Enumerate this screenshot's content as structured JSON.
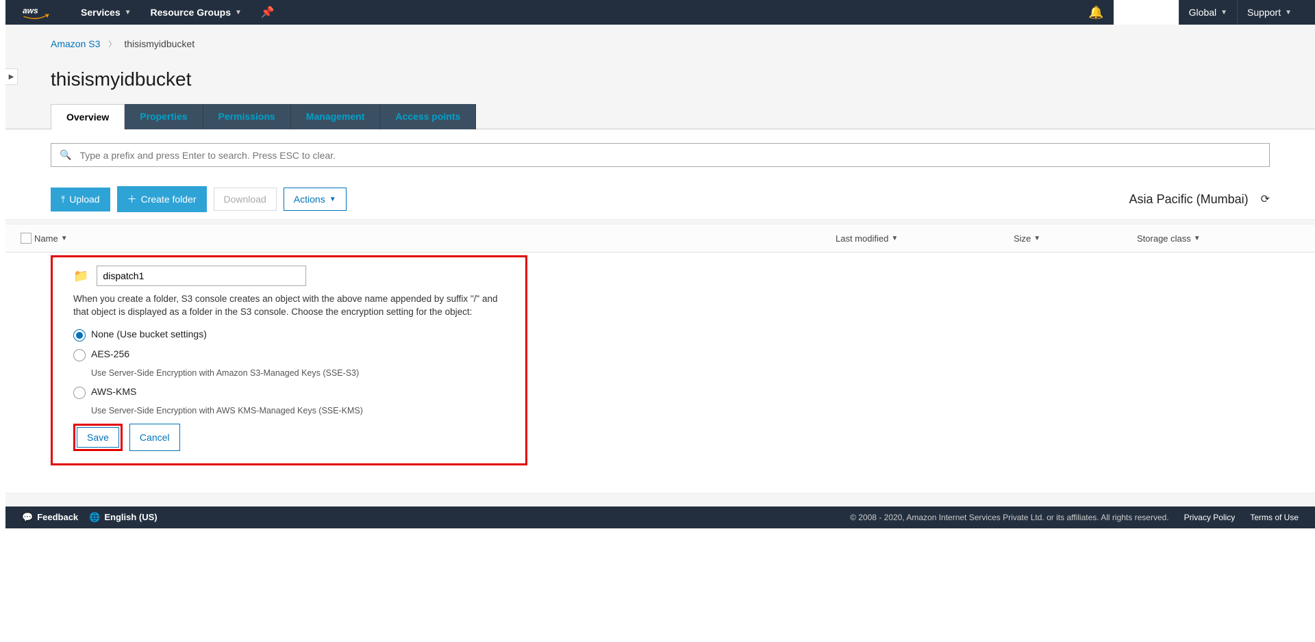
{
  "topnav": {
    "services": "Services",
    "resource_groups": "Resource Groups",
    "global": "Global",
    "support": "Support"
  },
  "breadcrumb": {
    "root": "Amazon S3",
    "current": "thisismyidbucket"
  },
  "heading": "thisismyidbucket",
  "tabs": {
    "overview": "Overview",
    "properties": "Properties",
    "permissions": "Permissions",
    "management": "Management",
    "access_points": "Access points"
  },
  "search": {
    "placeholder": "Type a prefix and press Enter to search. Press ESC to clear."
  },
  "actions": {
    "upload": "Upload",
    "create_folder": "Create folder",
    "download": "Download",
    "actions_menu": "Actions"
  },
  "region": {
    "label": "Asia Pacific (Mumbai)"
  },
  "table": {
    "name": "Name",
    "last_modified": "Last modified",
    "size": "Size",
    "storage_class": "Storage class"
  },
  "folder_form": {
    "input_value": "dispatch1",
    "description": "When you create a folder, S3 console creates an object with the above name appended by suffix \"/\" and that object is displayed as a folder in the S3 console. Choose the encryption setting for the object:",
    "opt_none": "None (Use bucket settings)",
    "opt_aes": "AES-256",
    "opt_aes_sub": "Use Server-Side Encryption with Amazon S3-Managed Keys (SSE-S3)",
    "opt_kms": "AWS-KMS",
    "opt_kms_sub": "Use Server-Side Encryption with AWS KMS-Managed Keys (SSE-KMS)",
    "save": "Save",
    "cancel": "Cancel"
  },
  "footer": {
    "feedback": "Feedback",
    "language": "English (US)",
    "copyright": "© 2008 - 2020, Amazon Internet Services Private Ltd. or its affiliates. All rights reserved.",
    "privacy": "Privacy Policy",
    "terms": "Terms of Use"
  }
}
